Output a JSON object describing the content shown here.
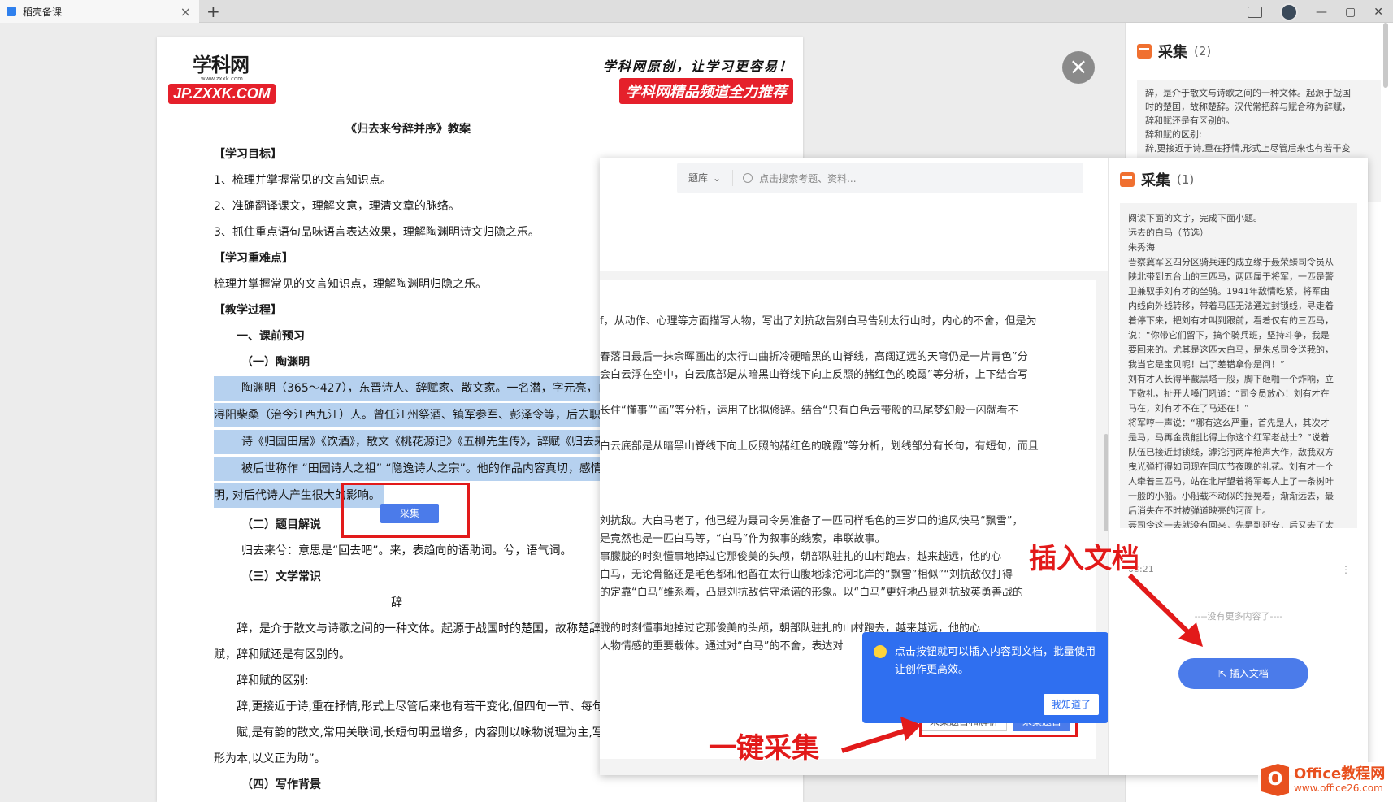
{
  "tab": {
    "title": "稻壳备课",
    "close": "×",
    "new": "+"
  },
  "window": {
    "minimize": "—",
    "maximize": "▢",
    "close": "✕"
  },
  "document": {
    "logo_text": "学科网",
    "logo_sub": "www.zxxk.com",
    "logo_domain": "JP.ZXXK.COM",
    "slogan": "学科网原创，让学习更容易！",
    "banner": "学科网精品频道全力推荐",
    "title": "《归去来兮辞并序》教案",
    "lines": [
      "【学习目标】",
      "1、梳理并掌握常见的文言知识点。",
      "2、准确翻译课文，理解文意，理清文章的脉络。",
      "3、抓住重点语句品味语言表达效果，理解陶渊明诗文归隐之乐。",
      "【学习重难点】",
      "梳理并掌握常见的文言知识点，理解陶渊明归隐之乐。",
      "【教学过程】",
      "一、课前预习",
      "（一）陶渊明",
      "陶渊明（365～427），东晋诗人、辞赋家、散文家。一名潜，字元亮，自号",
      "浔阳柴桑（治今江西九江）人。曾任江州祭酒、镇军参军、彭泽令等，后去职",
      "诗《归园田居》《饮酒》，散文《桃花源记》《五柳先生传》，辞赋《归去来",
      "被后世称作 “田园诗人之祖” “隐逸诗人之宗”。他的作品内容真切，感情",
      "明, 对后代诗人产生很大的影响。",
      "（二）题目解说",
      "归去来兮：意思是“回去吧”。来，表趋向的语助词。兮，语气词。",
      "（三）文学常识",
      "辞",
      "辞，是介于散文与诗歌之间的一种文体。起源于战国时的楚国，故称楚辞",
      "赋，辞和赋还是有区别的。",
      "辞和赋的区别:",
      "辞,更接近于诗,重在抒情,形式上尽管后来也有若干变化,但四句一节、每句",
      "赋,是有韵的散文,常用关联词,长短句明显增多，内容则以咏物说理为主,写",
      "形为本,以义正为助”。",
      "（四）写作背景"
    ],
    "collect_btn": "采集"
  },
  "close_overlay": "×",
  "outer_panel": {
    "title": "采集",
    "count": "(2)",
    "card_text": [
      "辞，是介于散文与诗歌之间的一种文体。起源于战国",
      "时的楚国，故称楚辞。汉代常把辞与赋合称为辞赋，",
      "辞和赋还是有区别的。",
      "辞和赋的区别:",
      "辞,更接近于诗,重在抒情,形式上尽管后来也有若干变"
    ]
  },
  "overlay": {
    "search_select": "题库",
    "search_placeholder": "点击搜索考题、资料...",
    "content_lines": [
      "f，从动作、心理等方面描写人物，写出了刘抗敌告别白马告别太行山时，内心的不舍，但是为",
      "春落日最后一抹余晖画出的太行山曲折冷硬暗黑的山脊线，高阔辽远的天穹仍是一片青色”分",
      "会白云浮在空中，白云底部是从暗黑山脊线下向上反照的赭红色的晚霞”等分析，上下结合写",
      "",
      "长住“懂事”“画”等分析，运用了比拟修辞。结合“只有白色云带般的马尾梦幻般一闪就看不",
      "",
      "白云底部是从暗黑山脊线下向上反照的赭红色的晚霞”等分析，划线部分有长句，有短句，而且",
      "",
      "",
      "刘抗敌。大白马老了，他已经为聂司令另准备了一匹同样毛色的三岁口的追风快马“飘雪”，",
      "是竟然也是一匹白马等，“白马”作为叙事的线索，串联故事。",
      "事朦胧的时刻懂事地掉过它那俊美的头颅，朝部队驻扎的山村跑去，越来越远，他的心",
      "白马，无论骨骼还是毛色都和他留在太行山腹地漆沱河北岸的“飘雪”相似”“刘抗敌仅打得",
      "的定靠“白马”维系着，凸显刘抗敌信守承诺的形象。以“白马”更好地凸显刘抗敌英勇善战的",
      "",
      "胧的时刻懂事地掉过它那俊美的头颅，朝部队驻扎的山村跑去，越来越远，他的心",
      "人物情感的重要载体。通过对“白马”的不舍，表达对"
    ],
    "btn_collect_analysis": "采集题目和解析",
    "btn_collect_question": "采集题目",
    "tip_text": "点击按钮就可以插入内容到文档，批量使用让创作更高效。",
    "tip_ok": "我知道了",
    "panel_title": "采集",
    "panel_count": "(1)",
    "card_lines": [
      "阅读下面的文字，完成下面小题。",
      "远去的白马（节选）",
      "朱秀海",
      "晋察冀军区四分区骑兵连的成立缘于聂荣臻司令员从",
      "陕北带到五台山的三匹马，两匹属于将军，一匹是警",
      "卫兼驭手刘有才的坐骑。1941年敌情吃紧，将军由",
      "内线向外线转移，带着马匹无法通过封锁线，寻走着",
      "着停下来，把刘有才叫到跟前，看着仅有的三匹马，",
      "说：“你带它们留下，搞个骑兵班，坚持斗争，我是",
      "要回来的。尤其是这匹大白马，是朱总司令送我的，",
      "我当它是宝贝呢！出了差错拿你是问！”",
      "刘有才人长得半截黑塔一般，脚下砸啪一个炸响，立",
      "正敬礼，扯开大嗓门吼道：“司令员放心！刘有才在",
      "马在，刘有才不在了马还在！”",
      "将军哼一声说：“哪有这么严重，首先是人，其次才",
      "是马，马再金贵能比得上你这个红军老战士？”说着",
      "队伍已接近封锁线，滹沱河两岸枪声大作，敌我双方",
      "曳光弹打得如同现在国庆节夜晚的礼花。刘有才一个",
      "人牵着三匹马，站在北岸望着将军每人上了一条树叶",
      "一般的小船。小船载不动似的摇晃着，渐渐远去，最",
      "后消失在不时被弹道映亮的河面上。",
      "聂司令这一去就没有回来，先是到延安，后又去了太"
    ],
    "time": "08:21",
    "more": "⋮",
    "no_more": "----没有更多内容了----",
    "insert_btn": "插入文档"
  },
  "annotations": {
    "insert": "插入文档",
    "one_click": "一键采集"
  },
  "watermark": {
    "title": "Office教程网",
    "url": "www.office26.com",
    "logo": "O"
  }
}
